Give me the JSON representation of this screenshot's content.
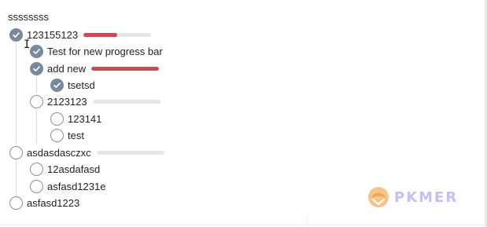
{
  "header": {
    "title": "ssssssss"
  },
  "items": [
    {
      "label": "123155123",
      "checked": true,
      "progress": 0.5
    },
    {
      "label": "Test for new progress bar",
      "checked": true
    },
    {
      "label": "add new",
      "checked": true,
      "progress": 1.0
    },
    {
      "label": "tsetsd",
      "checked": true
    },
    {
      "label": "2123123",
      "checked": false,
      "progress": 0.0
    },
    {
      "label": "123141",
      "checked": false
    },
    {
      "label": "test",
      "checked": false
    },
    {
      "label": "asdasdasczxc",
      "checked": false,
      "progress": 0.0
    },
    {
      "label": "12asdafasd",
      "checked": false
    },
    {
      "label": "asfasd1231e",
      "checked": false
    },
    {
      "label": "asfasd1223",
      "checked": false
    }
  ],
  "colors": {
    "checkbox_checked": "#7a8a9b",
    "progress_fill": "#c94a52",
    "progress_track": "#e6e6e6",
    "watermark": "#c3c0f2"
  },
  "watermark": {
    "text": "PKMER",
    "icon": "pkmer-logo-icon"
  }
}
